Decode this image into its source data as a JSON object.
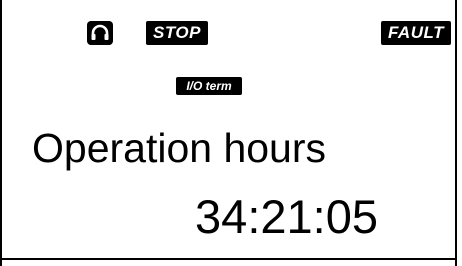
{
  "status_bar": {
    "control_icon": "remote-control-icon",
    "state_label": "STOP",
    "fault_label": "FAULT"
  },
  "control_place": {
    "label": "I/O term"
  },
  "parameter": {
    "name": "Operation hours",
    "value": "34:21:05"
  },
  "colors": {
    "foreground": "#000000",
    "background": "#ffffff"
  }
}
